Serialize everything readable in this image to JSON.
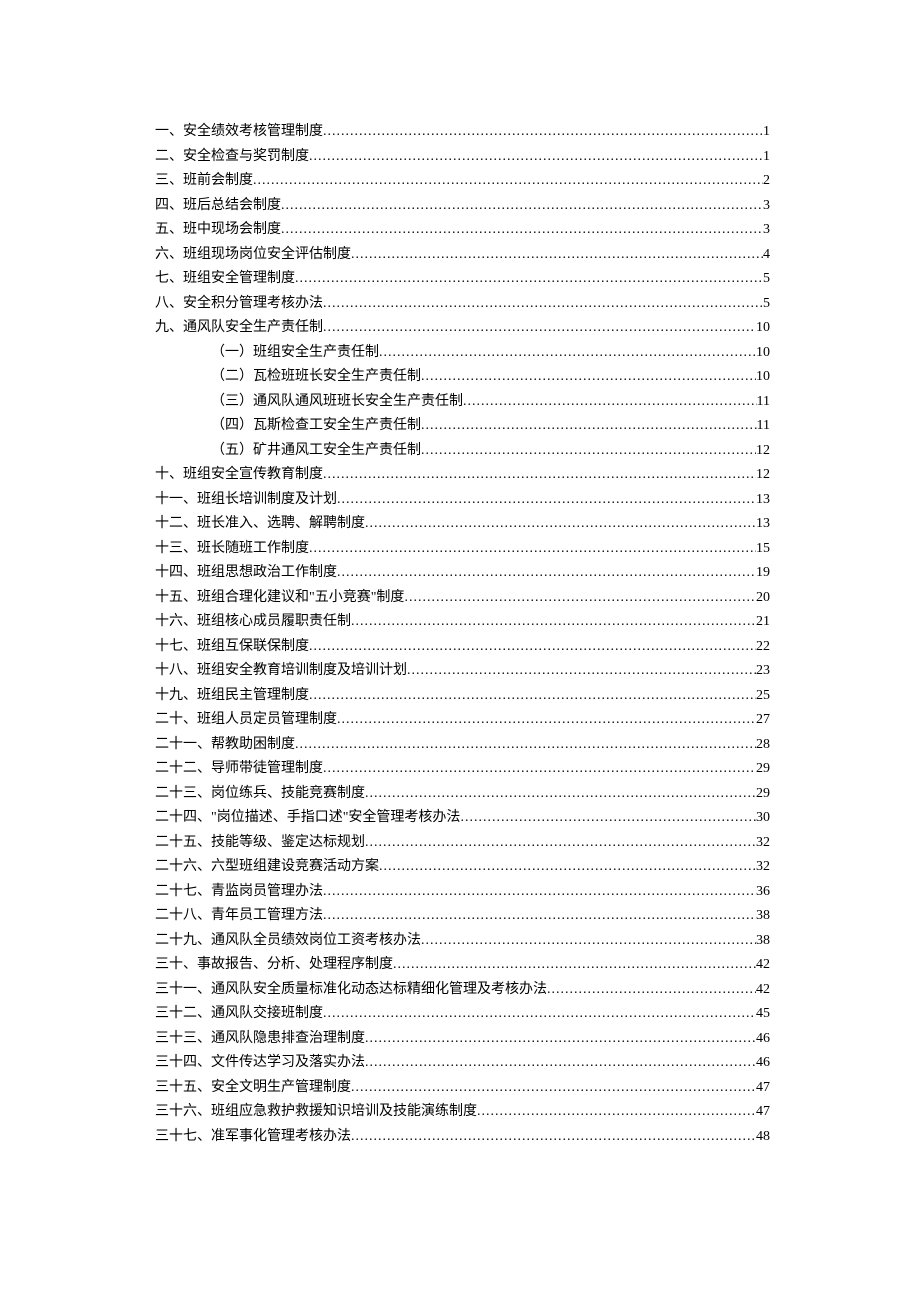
{
  "toc": [
    {
      "label": "一、安全绩效考核管理制度",
      "page": "1",
      "indent": 0
    },
    {
      "label": "二、安全检查与奖罚制度",
      "page": "1",
      "indent": 0
    },
    {
      "label": "三、班前会制度",
      "page": "2",
      "indent": 0
    },
    {
      "label": "四、班后总结会制度",
      "page": "3",
      "indent": 0
    },
    {
      "label": "五、班中现场会制度",
      "page": "3",
      "indent": 0
    },
    {
      "label": "六、班组现场岗位安全评估制度",
      "page": "4",
      "indent": 0
    },
    {
      "label": "七、班组安全管理制度",
      "page": "5",
      "indent": 0
    },
    {
      "label": "八、安全积分管理考核办法",
      "page": "5",
      "indent": 0
    },
    {
      "label": "九、通风队安全生产责任制",
      "page": "10",
      "indent": 0
    },
    {
      "label": "（一）班组安全生产责任制",
      "page": "10",
      "indent": 1
    },
    {
      "label": "（二）瓦检班班长安全生产责任制",
      "page": "10",
      "indent": 1
    },
    {
      "label": "（三）通风队通风班班长安全生产责任制",
      "page": "11",
      "indent": 1
    },
    {
      "label": "（四）瓦斯检查工安全生产责任制",
      "page": "11",
      "indent": 1
    },
    {
      "label": "（五）矿井通风工安全生产责任制",
      "page": "12",
      "indent": 1
    },
    {
      "label": "十、班组安全宣传教育制度",
      "page": "12",
      "indent": 0
    },
    {
      "label": "十一、班组长培训制度及计划",
      "page": "13",
      "indent": 0
    },
    {
      "label": "十二、班长准入、选聘、解聘制度",
      "page": "13",
      "indent": 0
    },
    {
      "label": "十三、班长随班工作制度",
      "page": "15",
      "indent": 0
    },
    {
      "label": "十四、班组思想政治工作制度",
      "page": "19",
      "indent": 0
    },
    {
      "label": "十五、班组合理化建议和\"五小竞赛\"制度",
      "page": "20",
      "indent": 0
    },
    {
      "label": "十六、班组核心成员履职责任制",
      "page": "21",
      "indent": 0
    },
    {
      "label": "十七、班组互保联保制度",
      "page": "22",
      "indent": 0
    },
    {
      "label": "十八、班组安全教育培训制度及培训计划",
      "page": "23",
      "indent": 0
    },
    {
      "label": "十九、班组民主管理制度",
      "page": "25",
      "indent": 0
    },
    {
      "label": "二十、班组人员定员管理制度",
      "page": "27",
      "indent": 0
    },
    {
      "label": "二十一、帮教助困制度",
      "page": "28",
      "indent": 0
    },
    {
      "label": "二十二、导师带徒管理制度",
      "page": "29",
      "indent": 0
    },
    {
      "label": "二十三、岗位练兵、技能竞赛制度",
      "page": "29",
      "indent": 0
    },
    {
      "label": "二十四、\"岗位描述、手指口述\"安全管理考核办法",
      "page": "30",
      "indent": 0
    },
    {
      "label": "二十五、技能等级、鉴定达标规划",
      "page": "32",
      "indent": 0
    },
    {
      "label": "二十六、六型班组建设竞赛活动方案",
      "page": "32",
      "indent": 0
    },
    {
      "label": "二十七、青监岗员管理办法",
      "page": "36",
      "indent": 0
    },
    {
      "label": "二十八、青年员工管理方法",
      "page": "38",
      "indent": 0
    },
    {
      "label": "二十九、通风队全员绩效岗位工资考核办法",
      "page": "38",
      "indent": 0
    },
    {
      "label": "三十、事故报告、分析、处理程序制度",
      "page": "42",
      "indent": 0
    },
    {
      "label": "三十一、通风队安全质量标准化动态达标精细化管理及考核办法",
      "page": "42",
      "indent": 0
    },
    {
      "label": "三十二、通风队交接班制度",
      "page": "45",
      "indent": 0
    },
    {
      "label": "三十三、通风队隐患排查治理制度",
      "page": "46",
      "indent": 0
    },
    {
      "label": "三十四、文件传达学习及落实办法",
      "page": "46",
      "indent": 0
    },
    {
      "label": "三十五、安全文明生产管理制度",
      "page": "47",
      "indent": 0
    },
    {
      "label": "三十六、班组应急救护救援知识培训及技能演练制度",
      "page": "47",
      "indent": 0
    },
    {
      "label": "三十七、准军事化管理考核办法",
      "page": "48",
      "indent": 0
    }
  ]
}
